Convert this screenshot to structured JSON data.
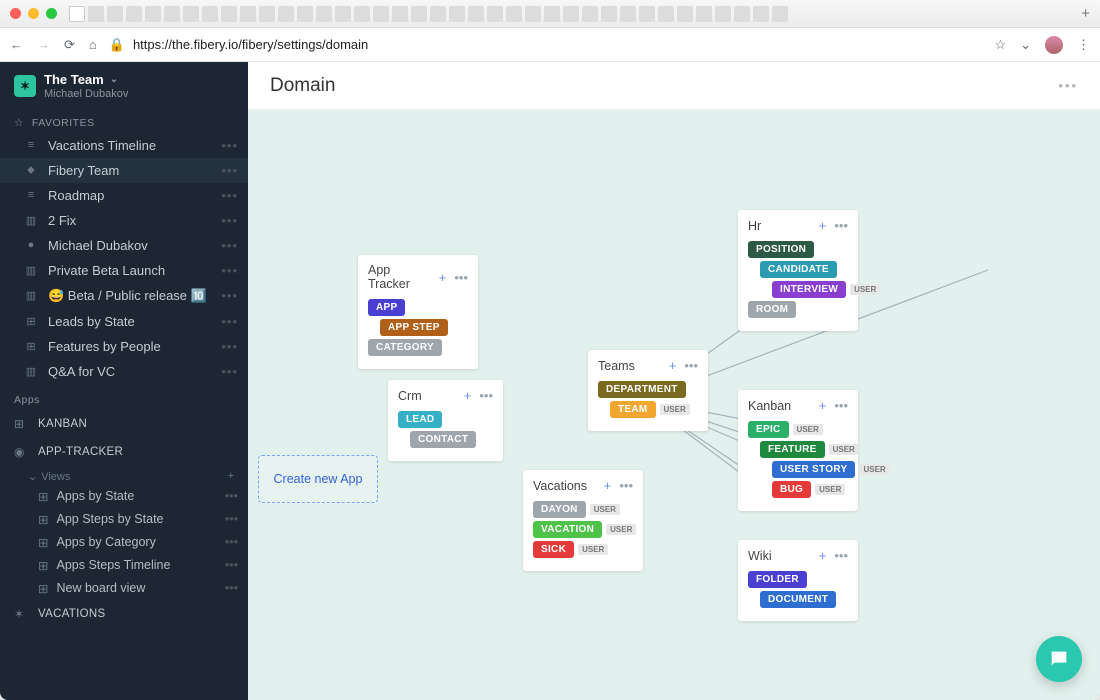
{
  "browser": {
    "url": "https://the.fibery.io/fibery/settings/domain",
    "tab_count": 38
  },
  "workspace": {
    "team": "The Team",
    "user": "Michael Dubakov"
  },
  "sidebar": {
    "favorites_label": "FAVORITES",
    "favorites": [
      {
        "label": "Vacations Timeline",
        "icon": "≡"
      },
      {
        "label": "Fibery Team",
        "icon": "⬥"
      },
      {
        "label": "Roadmap",
        "icon": "≡"
      },
      {
        "label": "2 Fix",
        "icon": "▥"
      },
      {
        "label": "Michael Dubakov",
        "icon": "●"
      },
      {
        "label": "Private Beta Launch",
        "icon": "▥"
      },
      {
        "label": "😅  Beta / Public release 🔟",
        "icon": "▥"
      },
      {
        "label": "Leads by State",
        "icon": "⊞"
      },
      {
        "label": "Features by People",
        "icon": "⊞"
      },
      {
        "label": "Q&A for VC",
        "icon": "▥"
      }
    ],
    "apps_label": "Apps",
    "apps": [
      {
        "label": "KANBAN",
        "icon": "⊞"
      },
      {
        "label": "APP-TRACKER",
        "icon": "◉"
      },
      {
        "label": "VACATIONS",
        "icon": "✶"
      }
    ],
    "views_label": "Views",
    "views": [
      {
        "label": "Apps by State"
      },
      {
        "label": "App Steps by State"
      },
      {
        "label": "Apps by Category"
      },
      {
        "label": "Apps Steps Timeline"
      },
      {
        "label": "New board view"
      }
    ]
  },
  "page": {
    "title": "Domain",
    "create_app": "Create new App"
  },
  "cards": {
    "app_tracker": {
      "title": "App Tracker",
      "entities": [
        {
          "label": "APP",
          "color": "#4a3fd1",
          "indent": 0
        },
        {
          "label": "APP STEP",
          "color": "#b16019",
          "indent": 1
        },
        {
          "label": "CATEGORY",
          "color": "#9ea6ac",
          "indent": 0
        }
      ]
    },
    "crm": {
      "title": "Crm",
      "entities": [
        {
          "label": "LEAD",
          "color": "#35b0c6",
          "indent": 0
        },
        {
          "label": "CONTACT",
          "color": "#9ea6ac",
          "indent": 1
        }
      ]
    },
    "teams": {
      "title": "Teams",
      "entities": [
        {
          "label": "DEPARTMENT",
          "color": "#7a6a1f",
          "indent": 0
        },
        {
          "label": "TEAM",
          "color": "#f0a62f",
          "indent": 1,
          "badge": "USER"
        }
      ]
    },
    "vacations": {
      "title": "Vacations",
      "entities": [
        {
          "label": "DAYON",
          "color": "#9ea6ac",
          "indent": 0,
          "badge": "USER"
        },
        {
          "label": "VACATION",
          "color": "#4fc24a",
          "indent": 0,
          "badge": "USER"
        },
        {
          "label": "SICK",
          "color": "#e43a3a",
          "indent": 0,
          "badge": "USER"
        }
      ]
    },
    "hr": {
      "title": "Hr",
      "entities": [
        {
          "label": "POSITION",
          "color": "#2d5a44",
          "indent": 0
        },
        {
          "label": "CANDIDATE",
          "color": "#2a9bb0",
          "indent": 1
        },
        {
          "label": "INTERVIEW",
          "color": "#8a3fd1",
          "indent": 2,
          "badge": "USER"
        },
        {
          "label": "ROOM",
          "color": "#9ea6ac",
          "indent": 0
        }
      ]
    },
    "kanban": {
      "title": "Kanban",
      "entities": [
        {
          "label": "EPIC",
          "color": "#2bb06a",
          "indent": 0,
          "badge": "USER"
        },
        {
          "label": "FEATURE",
          "color": "#1f8a3f",
          "indent": 1,
          "badge": "USER"
        },
        {
          "label": "USER STORY",
          "color": "#2f6ed1",
          "indent": 2,
          "badge": "USER"
        },
        {
          "label": "BUG",
          "color": "#e43a3a",
          "indent": 2,
          "badge": "USER"
        }
      ]
    },
    "wiki": {
      "title": "Wiki",
      "entities": [
        {
          "label": "FOLDER",
          "color": "#4a3fd1",
          "indent": 0
        },
        {
          "label": "DOCUMENT",
          "color": "#2f6ed1",
          "indent": 1
        }
      ]
    }
  }
}
